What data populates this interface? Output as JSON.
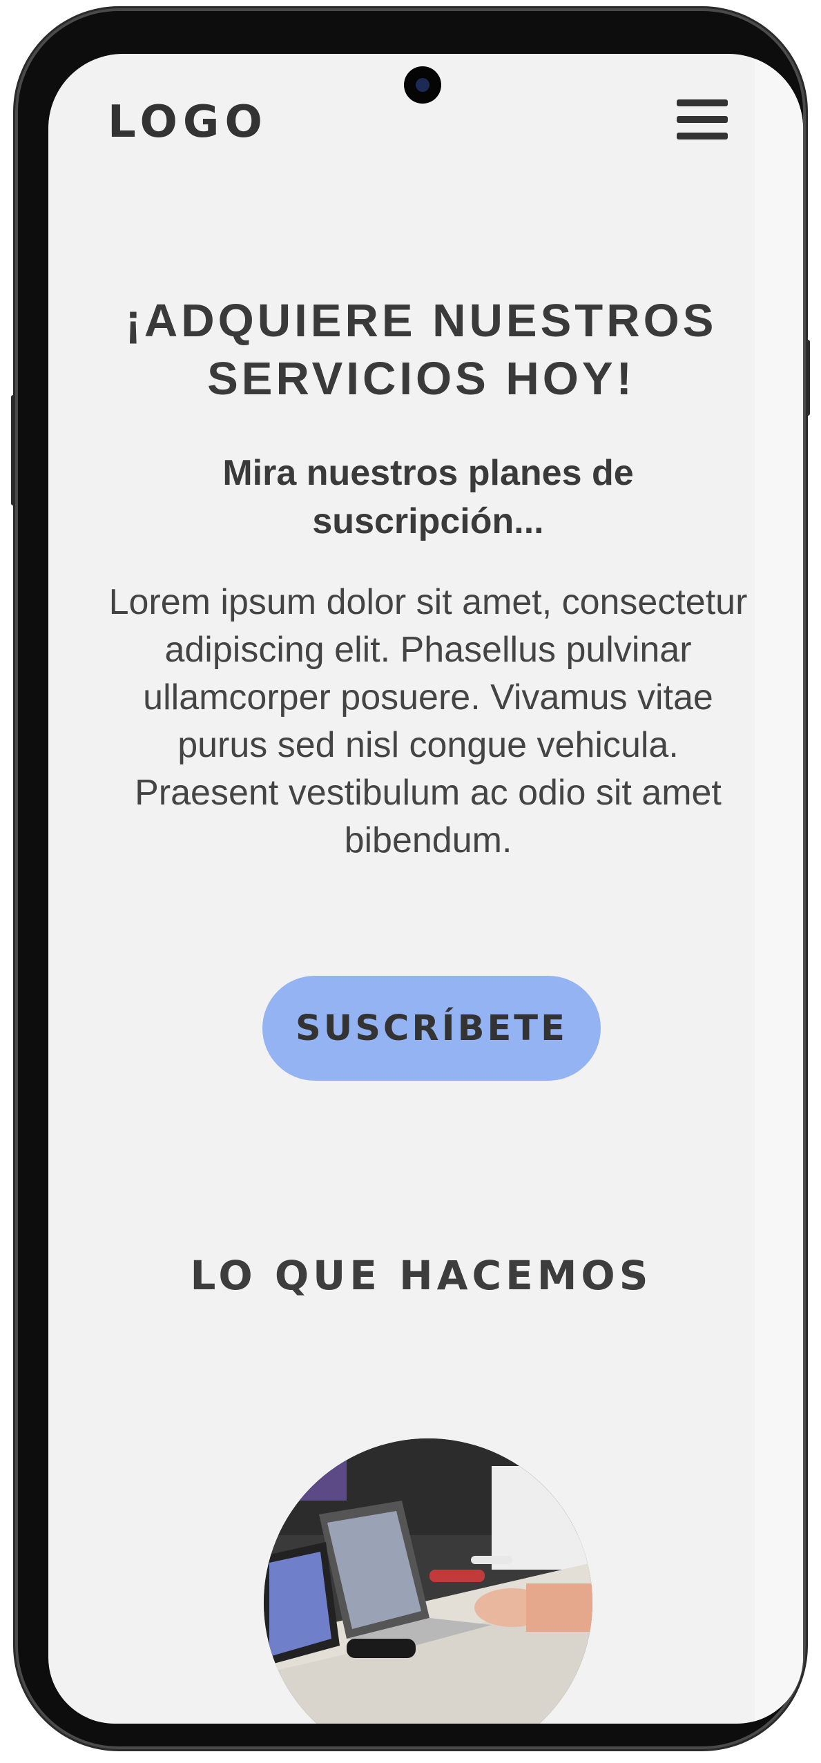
{
  "header": {
    "logo": "LOGO",
    "menu_icon": "hamburger-menu-icon"
  },
  "hero": {
    "title": "¡ADQUIERE NUESTROS SERVICIOS HOY!",
    "subtitle": "Mira nuestros planes de suscripción...",
    "body": "Lorem ipsum dolor sit amet, consectetur adipiscing elit. Phasellus pulvinar ullamcorper posuere. Vivamus vitae purus sed nisl congue vehicula. Praesent vestibulum ac odio sit amet bibendum.",
    "cta_label": "SUSCRÍBETE"
  },
  "services": {
    "title": "LO QUE HACEMOS",
    "image_icon": "team-working-laptops-photo"
  },
  "colors": {
    "background": "#f2f2f2",
    "button": "#94b3f2",
    "text": "#3a3a3a"
  }
}
